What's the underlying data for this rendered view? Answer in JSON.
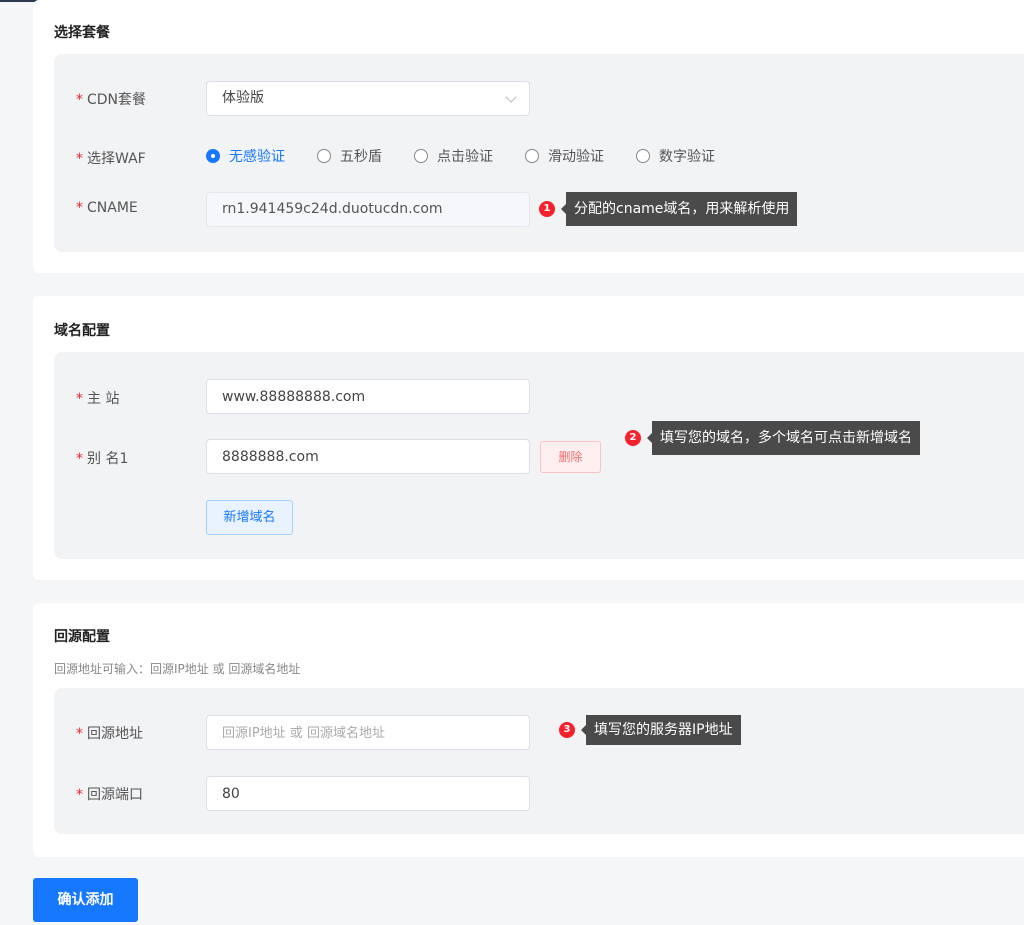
{
  "package_section": {
    "title": "选择套餐",
    "cdn": {
      "label": "CDN套餐",
      "value": "体验版"
    },
    "waf": {
      "label": "选择WAF",
      "options": [
        "无感验证",
        "五秒盾",
        "点击验证",
        "滑动验证",
        "数字验证"
      ],
      "selected": "无感验证"
    },
    "cname": {
      "label": "CNAME",
      "value": "rn1.941459c24d.duotucdn.com"
    },
    "tip": {
      "num": "1",
      "text": "分配的cname域名，用来解析使用"
    }
  },
  "domain_section": {
    "title": "域名配置",
    "main": {
      "label": "主 站",
      "value": "www.88888888.com"
    },
    "alias": {
      "label": "别 名1",
      "value": "8888888.com",
      "delete_label": "删除"
    },
    "add_label": "新增域名",
    "tip": {
      "num": "2",
      "text": "填写您的域名，多个域名可点击新增域名"
    }
  },
  "origin_section": {
    "title": "回源配置",
    "note": "回源地址可输入：回源IP地址 或 回源域名地址",
    "address": {
      "label": "回源地址",
      "placeholder": "回源IP地址 或 回源域名地址",
      "value": ""
    },
    "port": {
      "label": "回源端口",
      "value": "80"
    },
    "tip": {
      "num": "3",
      "text": "填写您的服务器IP地址"
    }
  },
  "confirm_label": "确认添加",
  "colors": {
    "accent": "#1677ff",
    "required": "#f5222d",
    "tooltip": "#4a4a4a"
  }
}
